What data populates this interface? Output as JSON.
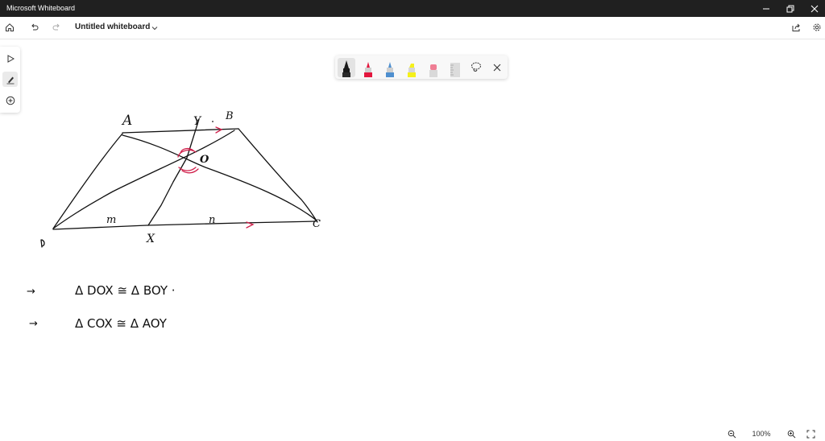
{
  "window": {
    "title": "Microsoft Whiteboard"
  },
  "header": {
    "board_title": "Untitled whiteboard"
  },
  "rail": {
    "tools": [
      "select-tool",
      "inking-tool",
      "add-tool"
    ],
    "active": "inking-tool"
  },
  "ink_toolbar": {
    "pens": [
      {
        "name": "black-pen",
        "color": "#111111"
      },
      {
        "name": "red-pen",
        "color": "#e3173e"
      },
      {
        "name": "blue-pen",
        "color": "#4f8fcf"
      },
      {
        "name": "yellow-highlighter",
        "color": "#f5f01a"
      },
      {
        "name": "eraser",
        "color": "#ef7e94"
      },
      {
        "name": "ruler",
        "color": "#b0b0b0"
      }
    ],
    "active_pen": "black-pen",
    "extra": [
      "lasso-select-icon",
      "close-icon"
    ]
  },
  "canvas": {
    "labels": {
      "A": "A",
      "Y": "Y",
      "B": "B",
      "O": "O",
      "D": "D",
      "X": "X",
      "C": "C",
      "m": "m",
      "n": "n"
    },
    "notes": [
      {
        "arrow": "→",
        "text": "Δ DOX  ≅ Δ BOY  ·"
      },
      {
        "arrow": "→",
        "text": "Δ COX  ≅ Δ AOY"
      }
    ]
  },
  "zoom": {
    "level": "100%"
  },
  "colors": {
    "ink": "#111111",
    "accent_ink": "#d01f4a",
    "titlebar": "#202020"
  }
}
